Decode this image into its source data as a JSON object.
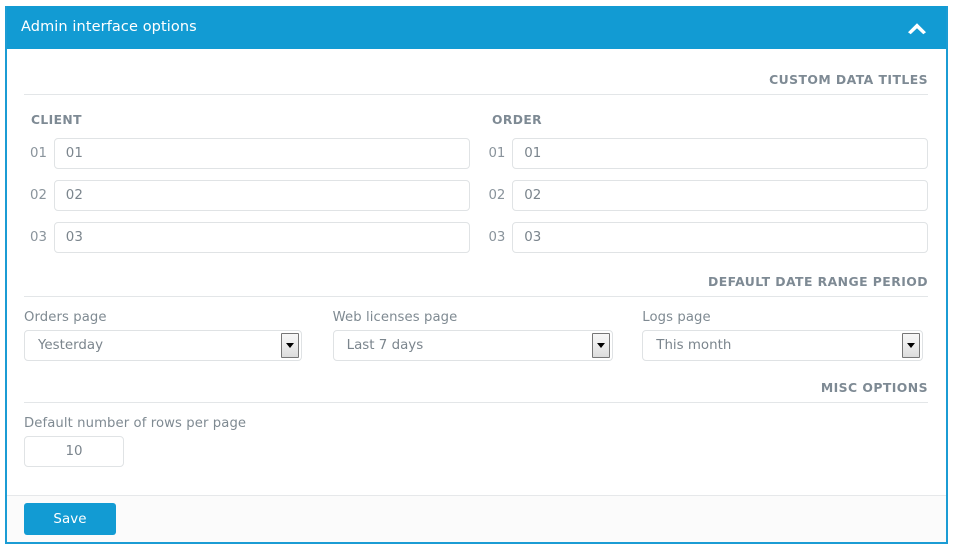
{
  "panel": {
    "title": "Admin interface options",
    "collapse_icon": "chevron-up-icon",
    "accent_color": "#129bd3",
    "border_color": "#1b9cd4"
  },
  "sections": {
    "custom_data_titles": {
      "heading": "CUSTOM DATA TITLES",
      "columns": [
        {
          "name": "client",
          "heading": "CLIENT",
          "rows": [
            {
              "index_label": "01",
              "value": "01",
              "placeholder": "01"
            },
            {
              "index_label": "02",
              "value": "02",
              "placeholder": "02"
            },
            {
              "index_label": "03",
              "value": "03",
              "placeholder": "03"
            }
          ]
        },
        {
          "name": "order",
          "heading": "ORDER",
          "rows": [
            {
              "index_label": "01",
              "value": "01",
              "placeholder": "01"
            },
            {
              "index_label": "02",
              "value": "02",
              "placeholder": "02"
            },
            {
              "index_label": "03",
              "value": "03",
              "placeholder": "03"
            }
          ]
        }
      ]
    },
    "default_date_range_period": {
      "heading": "DEFAULT DATE RANGE PERIOD",
      "selects": [
        {
          "name": "orders-page",
          "label": "Orders page",
          "value": "Yesterday"
        },
        {
          "name": "web-licenses-page",
          "label": "Web licenses page",
          "value": "Last 7 days"
        },
        {
          "name": "logs-page",
          "label": "Logs page",
          "value": "This month"
        }
      ]
    },
    "misc_options": {
      "heading": "MISC OPTIONS",
      "rows_per_page": {
        "label": "Default number of rows per page",
        "value": "10",
        "placeholder": "10"
      }
    }
  },
  "footer": {
    "save_label": "Save"
  }
}
